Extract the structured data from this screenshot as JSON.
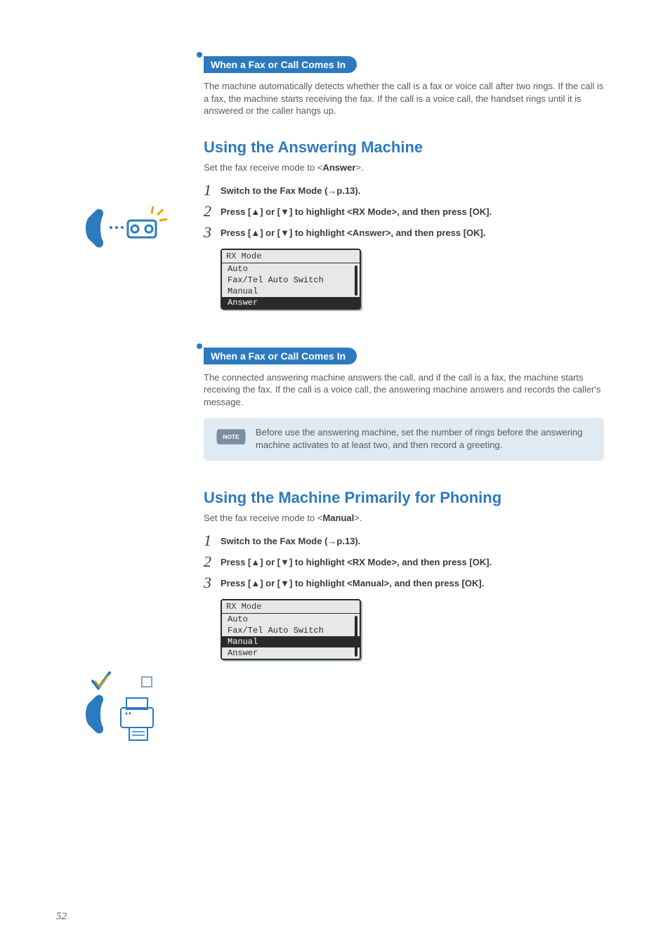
{
  "page_number": "52",
  "section1": {
    "callout": "When a Fax or Call Comes In",
    "body": "The machine automatically detects whether the call is a fax or voice call after two rings. If the call is a fax, the machine starts receiving the fax. If the call is a voice call, the handset rings until it is answered or the caller hangs up."
  },
  "section2": {
    "heading": "Using the Answering Machine",
    "intro_pre": "Set the fax receive mode to <",
    "intro_strong": "Answer",
    "intro_post": ">.",
    "steps": [
      {
        "num": "1",
        "text": "Switch to the Fax Mode (→p.13)."
      },
      {
        "num": "2",
        "text": "Press [▲] or [▼] to highlight <RX Mode>, and then press [OK]."
      },
      {
        "num": "3",
        "text": "Press [▲] or [▼] to highlight <Answer>, and then press [OK]."
      }
    ],
    "lcd": {
      "title": "RX Mode",
      "rows": [
        {
          "label": " Auto",
          "selected": false
        },
        {
          "label": " Fax/Tel Auto Switch",
          "selected": false
        },
        {
          "label": " Manual",
          "selected": false
        },
        {
          "label": " Answer",
          "selected": true
        }
      ]
    },
    "callout2": "When a Fax or Call Comes In",
    "body2": "The connected answering machine answers the call, and if the call is a fax, the machine starts receiving the fax. If the call is a voice call, the answering machine answers and records the caller's message.",
    "note_label": "NOTE",
    "note_text": "Before use the answering machine, set the number of rings before the answering machine activates to at least two, and then record a greeting."
  },
  "section3": {
    "heading": "Using the Machine Primarily for Phoning",
    "intro_pre": "Set the fax receive mode to <",
    "intro_strong": "Manual",
    "intro_post": ">.",
    "steps": [
      {
        "num": "1",
        "text": "Switch to the Fax Mode (→p.13)."
      },
      {
        "num": "2",
        "text": "Press [▲] or [▼] to highlight <RX Mode>, and then press [OK]."
      },
      {
        "num": "3",
        "text": "Press [▲] or [▼] to highlight <Manual>, and then press [OK]."
      }
    ],
    "lcd": {
      "title": "RX Mode",
      "rows": [
        {
          "label": " Auto",
          "selected": false
        },
        {
          "label": " Fax/Tel Auto Switch",
          "selected": false
        },
        {
          "label": " Manual",
          "selected": true
        },
        {
          "label": " Answer",
          "selected": false
        }
      ]
    }
  }
}
